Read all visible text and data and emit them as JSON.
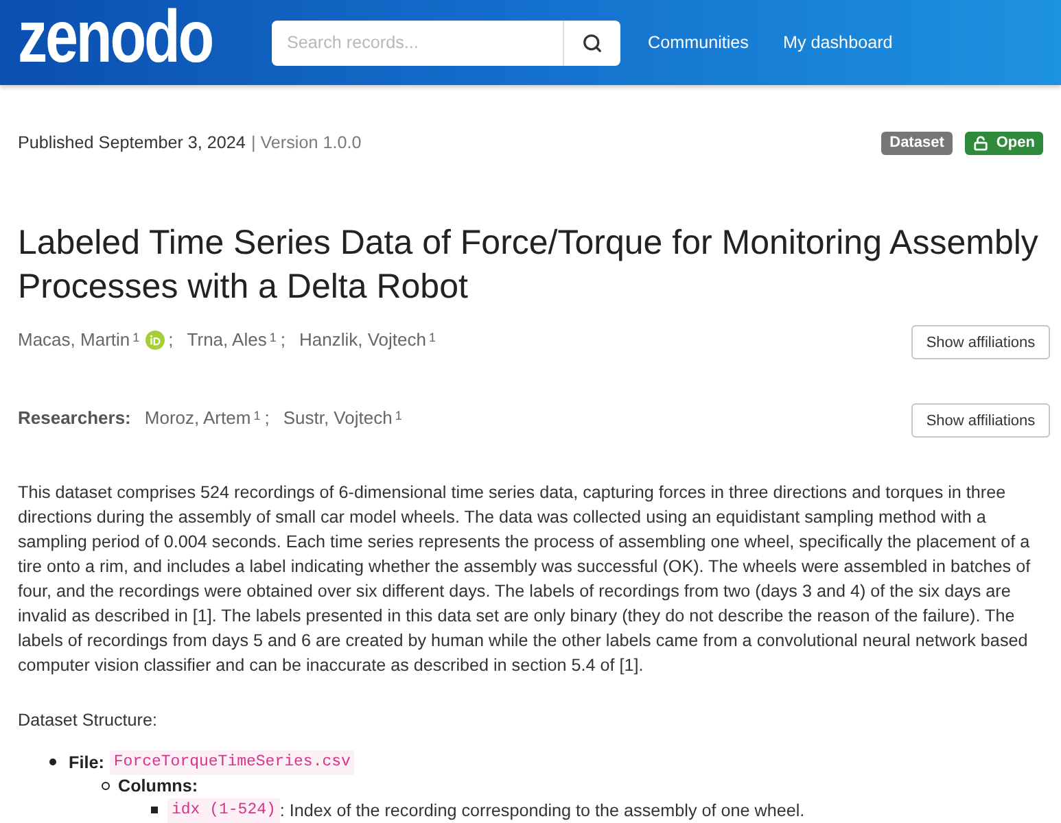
{
  "header": {
    "logo": "zenodo",
    "search": {
      "placeholder": "Search records..."
    },
    "nav": [
      "Communities",
      "My dashboard"
    ]
  },
  "record": {
    "published": "Published September 3, 2024",
    "separator": "|",
    "version": "Version 1.0.0",
    "badges": [
      {
        "label": "Dataset",
        "kind": "type",
        "color": "#767676"
      },
      {
        "label": "Open",
        "kind": "access",
        "color": "#2f8a3c"
      }
    ]
  },
  "title": "Labeled Time Series Data of Force/Torque for Monitoring Assembly Processes with a Delta Robot",
  "creators": {
    "people": [
      {
        "name": "Macas, Martin",
        "affiliation": "1",
        "orcid": true,
        "separator": ";"
      },
      {
        "name": "Trna, Ales",
        "affiliation": "1",
        "orcid": false,
        "separator": ";"
      },
      {
        "name": "Hanzlik, Vojtech",
        "affiliation": "1",
        "orcid": false
      }
    ],
    "button": "Show affiliations"
  },
  "researchers": {
    "label": "Researchers:",
    "people": [
      {
        "name": "Moroz, Artem",
        "affiliation": "1",
        "orcid": false,
        "separator": ";"
      },
      {
        "name": "Sustr, Vojtech",
        "affiliation": "1",
        "orcid": false
      }
    ],
    "button": "Show affiliations"
  },
  "description": "This dataset comprises 524 recordings of 6-dimensional time series data, capturing forces in three directions and torques in three directions during the assembly of small car model wheels. The data was collected using an equidistant sampling method with a sampling period of 0.004 seconds. Each time series represents the process of assembling one wheel, specifically the placement of a tire onto a rim, and includes a label indicating whether the assembly was successful (OK). The wheels were assembled in batches of four, and the recordings were obtained over six different days. The labels of recordings from two (days 3 and 4) of the six days are invalid as described in [1]. The labels presented in this data set are only binary (they do not describe the reason of the failure). The labels of recordings from days 5 and 6 are created by human while the other labels came from a convolutional neural network based computer vision classifier and can be inaccurate as described in section 5.4 of [1].",
  "structure": {
    "heading": "Dataset Structure:",
    "items": [
      {
        "label": "File:",
        "code": "ForceTorqueTimeSeries.csv",
        "children": [
          {
            "label": "Columns:",
            "children": [
              {
                "code": "idx (1-524)",
                "text": ": Index of the recording corresponding to the assembly of one wheel."
              }
            ]
          }
        ]
      }
    ]
  }
}
